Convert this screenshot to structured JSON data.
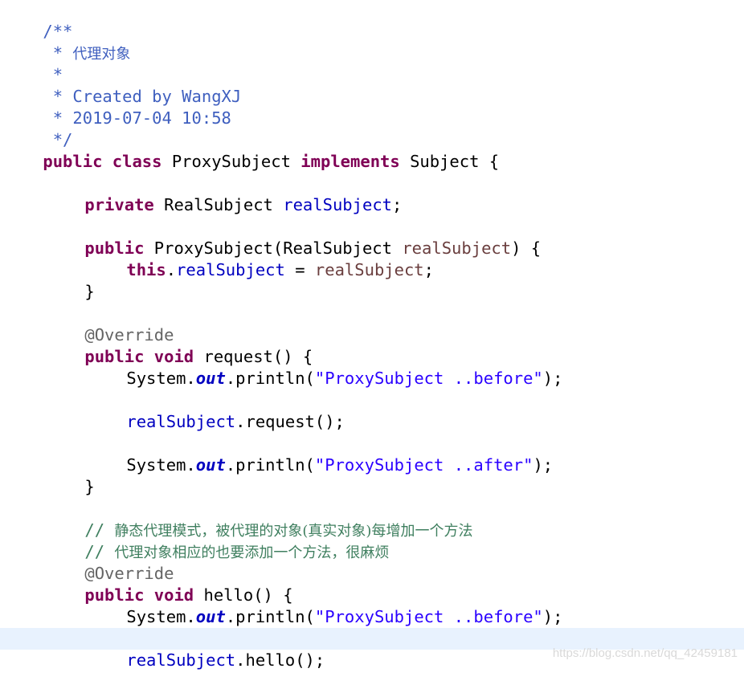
{
  "code": {
    "doc_open": "/**",
    "doc_star": " *",
    "doc_title_prefix": " * ",
    "doc_title": "代理对象",
    "doc_created": " * Created by WangXJ",
    "doc_date": " * 2019-07-04 10:58",
    "doc_close": " */",
    "kw_public": "public",
    "kw_class": "class",
    "class_name": "ProxySubject",
    "kw_implements": "implements",
    "interface_name": "Subject {",
    "kw_private": "private",
    "field_type": "RealSubject",
    "field_name": "realSubject",
    "semicolon": ";",
    "ctor_name": "ProxySubject(RealSubject",
    "param_name": "realSubject",
    "ctor_tail": ") {",
    "kw_this": "this",
    "dot": ".",
    "assign": " = ",
    "close_brace": "}",
    "annotation": "@Override",
    "kw_void": "void",
    "method_request": "request() {",
    "system": "System.",
    "out": "out",
    "println_open": ".println(",
    "str_before": "\"ProxySubject ..before\"",
    "str_after": "\"ProxySubject ..after\"",
    "println_close": ");",
    "call_request": ".request();",
    "comment1_prefix": "// ",
    "comment1": "静态代理模式，被代理的对象(真实对象)每增加一个方法",
    "comment2_prefix": "// ",
    "comment2": "代理对象相应的也要添加一个方法，很麻烦",
    "method_hello": "hello() {",
    "call_hello": ".hello();"
  },
  "watermark": "https://blog.csdn.net/qq_42459181"
}
